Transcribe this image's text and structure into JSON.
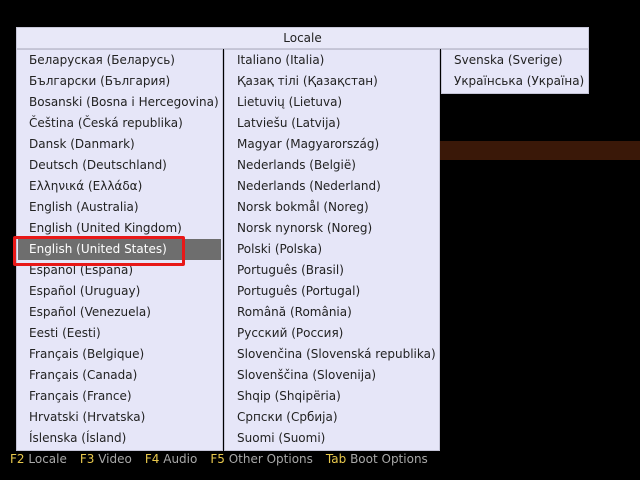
{
  "menu": {
    "title": "Locale",
    "columns": [
      [
        "Беларуская (Беларусь)",
        "Български (България)",
        "Bosanski (Bosna i Hercegovina)",
        "Čeština (Česká republika)",
        "Dansk (Danmark)",
        "Deutsch (Deutschland)",
        "Ελληνικά (Ελλάδα)",
        "English (Australia)",
        "English (United Kingdom)",
        "English (United States)",
        "Español (España)",
        "Español (Uruguay)",
        "Español (Venezuela)",
        "Eesti (Eesti)",
        "Français (Belgique)",
        "Français (Canada)",
        "Français (France)",
        "Hrvatski (Hrvatska)",
        "Íslenska (Ísland)"
      ],
      [
        "Italiano (Italia)",
        "Қазақ тілі (Қазақстан)",
        "Lietuvių (Lietuva)",
        "Latviešu (Latvija)",
        "Magyar (Magyarország)",
        "Nederlands (België)",
        "Nederlands (Nederland)",
        "Norsk bokmål (Noreg)",
        "Norsk nynorsk (Noreg)",
        "Polski (Polska)",
        "Português (Brasil)",
        "Português (Portugal)",
        "Română (România)",
        "Русский (Россия)",
        "Slovenčina (Slovenská republika)",
        "Slovenščina (Slovenija)",
        "Shqip (Shqipëria)",
        "Српски (Србија)",
        "Suomi (Suomi)"
      ],
      [
        "Svenska (Sverige)",
        "Українська (Україна)"
      ]
    ],
    "selected": "English (United States)"
  },
  "footer": [
    {
      "key": "F2",
      "label": "Locale"
    },
    {
      "key": "F3",
      "label": "Video"
    },
    {
      "key": "F4",
      "label": "Audio"
    },
    {
      "key": "F5",
      "label": "Other Options"
    },
    {
      "key": "Tab",
      "label": "Boot Options"
    }
  ],
  "colors": {
    "background": "#000000",
    "menu_bg": "#e6e6f8",
    "selected_bg": "#6e6e6e",
    "highlight_border": "#e81818",
    "key_color": "#e8c84c",
    "footer_text": "#a8a8a8"
  }
}
